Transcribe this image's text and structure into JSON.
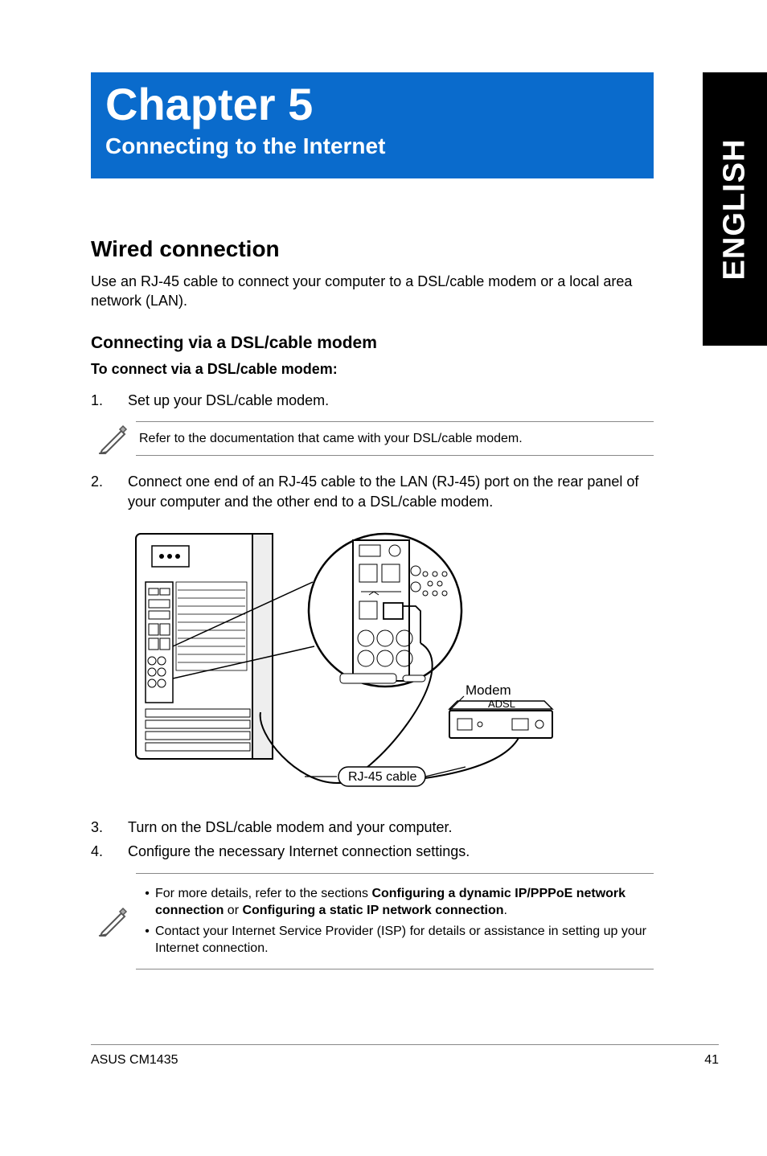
{
  "side_tab": "ENGLISH",
  "chapter": {
    "title": "Chapter 5",
    "subtitle": "Connecting to the Internet"
  },
  "section": {
    "h2": "Wired connection",
    "intro": "Use an RJ-45 cable to connect your computer to a DSL/cable modem or a local area network (LAN).",
    "h3": "Connecting via a DSL/cable modem",
    "h4": "To connect via a DSL/cable modem:",
    "steps": {
      "s1_num": "1.",
      "s1_text": "Set up your DSL/cable modem.",
      "s2_num": "2.",
      "s2_text": "Connect one end of an RJ-45 cable to the LAN (RJ-45) port on the rear panel of your computer and the other end to a DSL/cable modem.",
      "s3_num": "3.",
      "s3_text": "Turn on the DSL/cable modem and your computer.",
      "s4_num": "4.",
      "s4_text": "Configure the necessary Internet connection settings."
    },
    "note1": "Refer to the documentation that came with your DSL/cable modem.",
    "note2": {
      "b1_pre": "For more details, refer to the sections ",
      "b1_bold1": "Configuring a dynamic IP/PPPoE network connection",
      "b1_mid": " or ",
      "b1_bold2": "Configuring a static IP network connection",
      "b1_post": ".",
      "b2": "Contact your Internet Service Provider (ISP) for details or assistance in setting up your Internet connection."
    },
    "figure": {
      "label_modem": "Modem",
      "label_cable": "RJ-45 cable"
    }
  },
  "footer": {
    "left": "ASUS CM1435",
    "right": "41"
  }
}
